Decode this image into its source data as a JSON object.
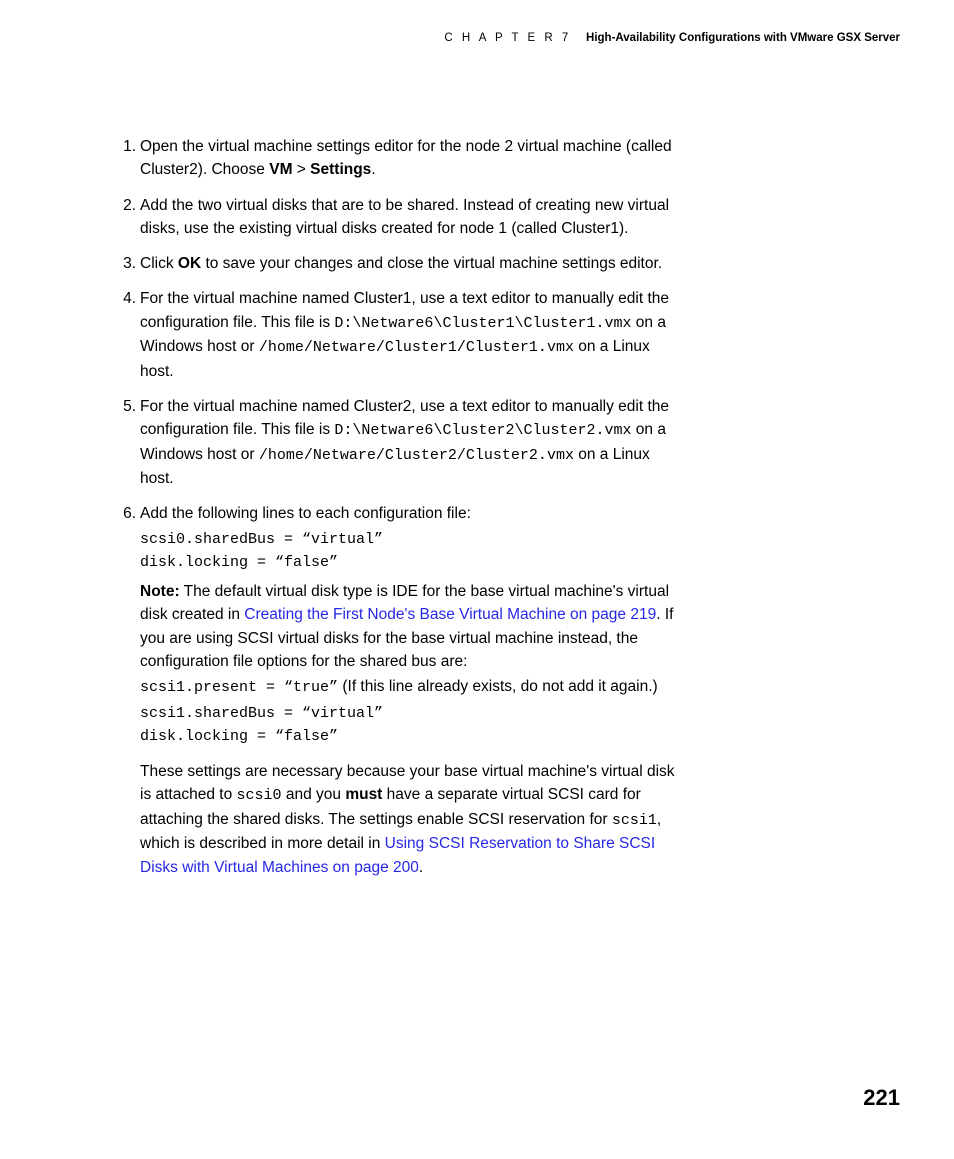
{
  "header": {
    "chapter_label": "C H A P T E R   7",
    "chapter_title": "High-Availability Configurations with VMware GSX Server"
  },
  "steps": {
    "s1": {
      "p1a": "Open the virtual machine settings editor for the node 2 virtual machine (called Cluster2). Choose ",
      "vm": "VM",
      "gt": " > ",
      "settings": "Settings",
      "p1b": "."
    },
    "s2": "Add the two virtual disks that are to be shared. Instead of creating new virtual disks, use the existing virtual disks created for node 1 (called Cluster1).",
    "s3": {
      "a": "Click ",
      "ok": "OK",
      "b": " to save your changes and close the virtual machine settings editor."
    },
    "s4": {
      "a": "For the virtual machine named Cluster1, use a text editor to manually edit the configuration file. This file is ",
      "path_win": "D:\\Netware6\\Cluster1\\Cluster1.vmx",
      "b": " on a Windows host or ",
      "path_lin": "/home/Netware/Cluster1/Cluster1.vmx",
      "c": " on a Linux host."
    },
    "s5": {
      "a": "For the virtual machine named Cluster2, use a text editor to manually edit the configuration file. This file is ",
      "path_win": "D:\\Netware6\\Cluster2\\Cluster2.vmx",
      "b": " on a Windows host or ",
      "path_lin": "/home/Netware/Cluster2/Cluster2.vmx",
      "c": " on a Linux host."
    },
    "s6": {
      "intro": "Add the following lines to each configuration file:",
      "code1": "scsi0.sharedBus = “virtual”\ndisk.locking = “false”",
      "note_label": "Note:",
      "note_a": "  The default virtual disk type is IDE for the base virtual machine's virtual disk created in ",
      "note_link": "Creating the First Node's Base Virtual Machine on page 219",
      "note_b": ". If you are using SCSI virtual disks for the base virtual machine instead, the configuration file options for the shared bus are:",
      "code2_line": "scsi1.present = “true”",
      "code2_aside": "  (If this line already exists, do not add it again.)",
      "code2_rest": "scsi1.sharedBus = “virtual”\ndisk.locking = “false”"
    }
  },
  "closing": {
    "a": "These settings are necessary because your base virtual machine's virtual disk is attached to ",
    "scsi0": "scsi0",
    "b": " and you ",
    "must": "must",
    "c": " have a separate virtual SCSI card for attaching the shared disks. The settings enable SCSI reservation for ",
    "scsi1": "scsi1",
    "d": ", which is described in more detail in ",
    "link": "Using SCSI Reservation to Share SCSI Disks with Virtual Machines on page 200",
    "e": "."
  },
  "page_number": "221"
}
